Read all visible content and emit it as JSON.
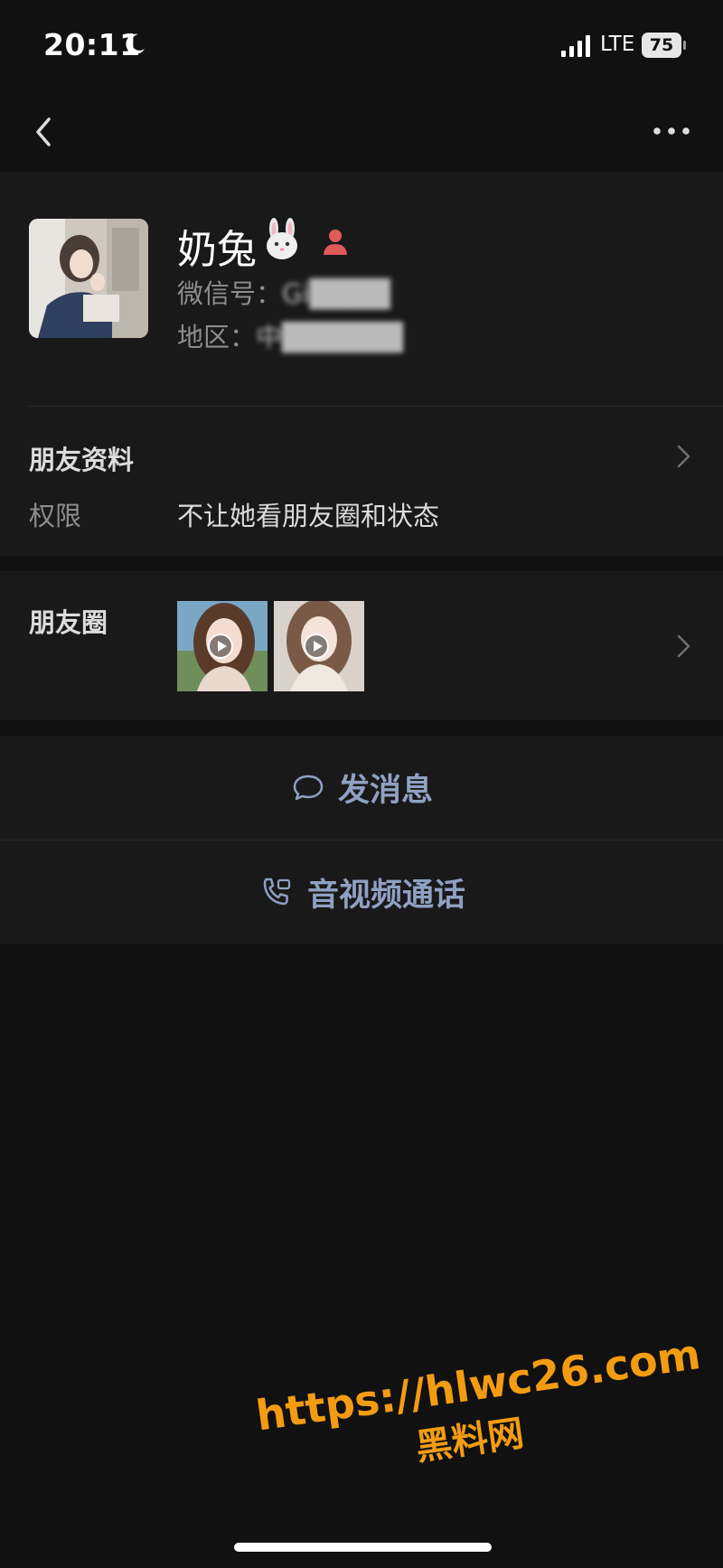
{
  "status_bar": {
    "time": "20:11",
    "network": "LTE",
    "battery": "75"
  },
  "nav": {
    "back_icon": "chevron-left-icon",
    "more_icon": "more-icon"
  },
  "profile": {
    "name": "奶兔",
    "wechat_id_label": "微信号：",
    "wechat_id_value": "Gi████",
    "region_label": "地区：",
    "region_value": "中██████"
  },
  "friend_info": {
    "title": "朋友资料",
    "permission_label": "权限",
    "permission_value": "不让她看朋友圈和状态"
  },
  "moments": {
    "title": "朋友圈"
  },
  "actions": {
    "message": "发消息",
    "call": "音视频通话"
  },
  "watermark": {
    "url": "https://hlwc26.com",
    "site": "黑料网"
  },
  "colors": {
    "background": "#111111",
    "card": "#191919",
    "link": "#8fa1c3",
    "watermark": "#f39c12"
  }
}
